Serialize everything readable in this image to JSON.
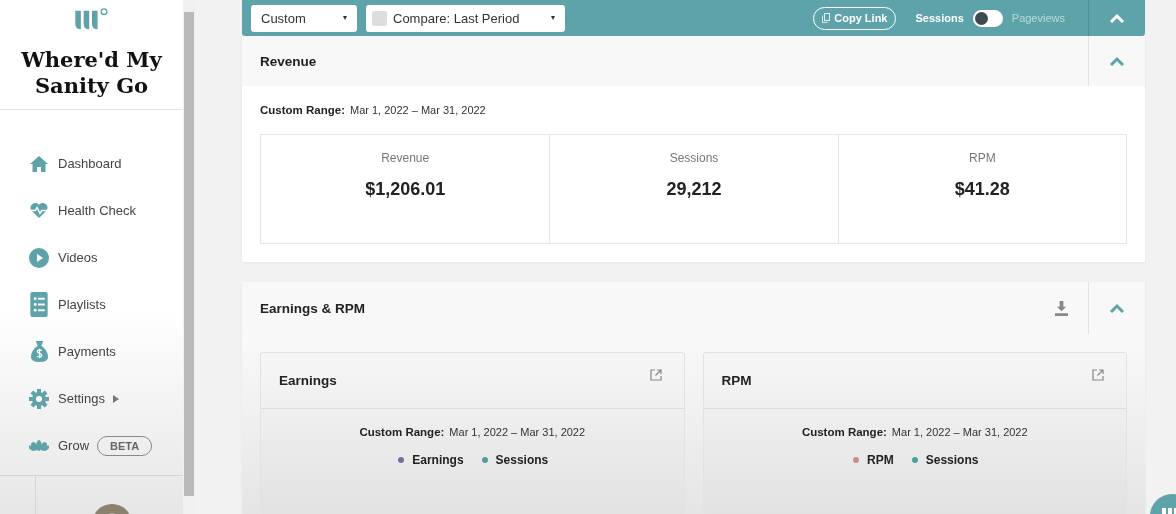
{
  "sidebar": {
    "brand": "Where'd My Sanity Go",
    "items": [
      {
        "label": "Dashboard"
      },
      {
        "label": "Health Check"
      },
      {
        "label": "Videos"
      },
      {
        "label": "Playlists"
      },
      {
        "label": "Payments"
      },
      {
        "label": "Settings",
        "submenu": true
      },
      {
        "label": "Grow",
        "badge": "BETA"
      }
    ]
  },
  "toolbar": {
    "range_select": "Custom",
    "compare": {
      "label": "Compare: Last Period",
      "checked": false
    },
    "copy_link": "Copy Link",
    "metric_options": [
      {
        "label": "Sessions",
        "selected": true
      },
      {
        "label": "Pageviews",
        "selected": false
      }
    ]
  },
  "revenue": {
    "title": "Revenue",
    "range_label": "Custom Range:",
    "range": "Mar 1, 2022 – Mar 31, 2022",
    "metrics": [
      {
        "label": "Revenue",
        "value": "$1,206.01"
      },
      {
        "label": "Sessions",
        "value": "29,212"
      },
      {
        "label": "RPM",
        "value": "$41.28"
      }
    ]
  },
  "earnings_rpm": {
    "title": "Earnings & RPM",
    "charts": [
      {
        "title": "Earnings",
        "range_label": "Custom Range:",
        "range": "Mar 1, 2022 – Mar 31, 2022",
        "legend": [
          {
            "label": "Earnings",
            "color": "#7a6d9c"
          },
          {
            "label": "Sessions",
            "color": "#4f9c9f"
          }
        ]
      },
      {
        "title": "RPM",
        "range_label": "Custom Range:",
        "range": "Mar 1, 2022 – Mar 31, 2022",
        "legend": [
          {
            "label": "RPM",
            "color": "#c98c8c"
          },
          {
            "label": "Sessions",
            "color": "#4f9c9f"
          }
        ]
      }
    ]
  }
}
